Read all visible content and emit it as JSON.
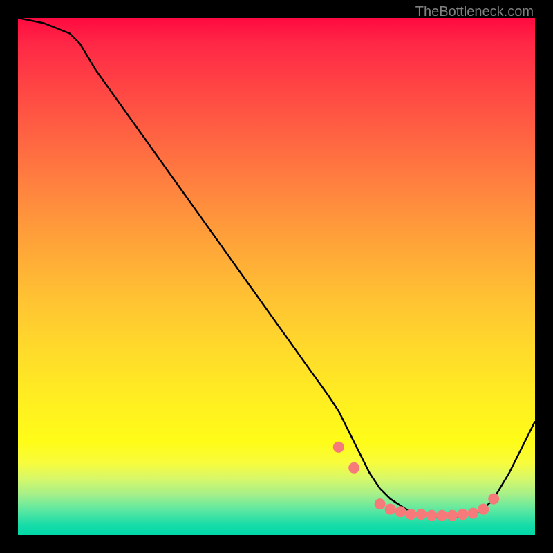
{
  "watermark": "TheBottleneck.com",
  "chart_data": {
    "type": "line",
    "title": "",
    "xlabel": "",
    "ylabel": "",
    "xlim": [
      0,
      100
    ],
    "ylim": [
      0,
      100
    ],
    "gradient_stops": [
      {
        "offset": 0,
        "color": "#ff0a40"
      },
      {
        "offset": 5,
        "color": "#ff2846"
      },
      {
        "offset": 15,
        "color": "#ff4a44"
      },
      {
        "offset": 25,
        "color": "#ff6a42"
      },
      {
        "offset": 35,
        "color": "#ff8a3e"
      },
      {
        "offset": 45,
        "color": "#ffa838"
      },
      {
        "offset": 55,
        "color": "#ffc432"
      },
      {
        "offset": 65,
        "color": "#ffdc2a"
      },
      {
        "offset": 75,
        "color": "#fff020"
      },
      {
        "offset": 82,
        "color": "#fffc18"
      },
      {
        "offset": 86,
        "color": "#f8fc3c"
      },
      {
        "offset": 89,
        "color": "#d8f868"
      },
      {
        "offset": 92,
        "color": "#a8f088"
      },
      {
        "offset": 95,
        "color": "#60e8a0"
      },
      {
        "offset": 98,
        "color": "#18dca8"
      },
      {
        "offset": 100,
        "color": "#00d8a8"
      }
    ],
    "curve": {
      "x": [
        0,
        5,
        10,
        12,
        15,
        20,
        25,
        30,
        35,
        40,
        45,
        50,
        55,
        60,
        62,
        65,
        68,
        70,
        72,
        75,
        78,
        80,
        82,
        85,
        88,
        90,
        92,
        95,
        100
      ],
      "y": [
        100,
        99,
        97,
        95,
        90,
        83,
        76,
        69,
        62,
        55,
        48,
        41,
        34,
        27,
        24,
        18,
        12,
        9,
        7,
        5,
        4,
        3.5,
        3.5,
        3.5,
        4,
        5,
        7,
        12,
        22
      ]
    },
    "markers": {
      "x": [
        62,
        65,
        70,
        72,
        74,
        76,
        78,
        80,
        82,
        84,
        86,
        88,
        90,
        92
      ],
      "y": [
        17,
        13,
        6,
        5,
        4.5,
        4,
        4,
        3.8,
        3.8,
        3.8,
        4,
        4.2,
        5,
        7
      ],
      "color": "#f77a7a",
      "size": 8
    }
  }
}
